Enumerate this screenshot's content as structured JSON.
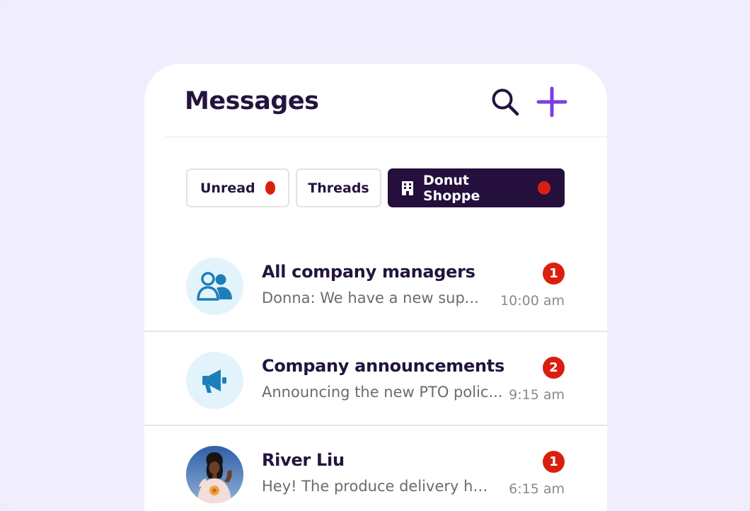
{
  "header": {
    "title": "Messages"
  },
  "filters": [
    {
      "label": "Unread",
      "has_dot": true
    },
    {
      "label": "Threads",
      "has_dot": false
    },
    {
      "label": "Donut Shoppe",
      "has_dot": true,
      "active": true,
      "icon": "building-icon"
    }
  ],
  "conversations": [
    {
      "title": "All company managers",
      "preview": "Donna: We have a new sup...",
      "time": "10:00 am",
      "unread": "1",
      "avatar": "group-icon"
    },
    {
      "title": "Company announcements",
      "preview": "Announcing the new PTO polic...",
      "time": "9:15 am",
      "unread": "2",
      "avatar": "megaphone-icon"
    },
    {
      "title": "River Liu",
      "preview": "Hey! The produce delivery ha...",
      "time": "6:15 am",
      "unread": "1",
      "avatar": "user-photo"
    }
  ],
  "colors": {
    "accent": "#7b3fe4",
    "dark": "#240f3d",
    "badge": "#d9200f",
    "icon_blue": "#1b7fb8"
  }
}
